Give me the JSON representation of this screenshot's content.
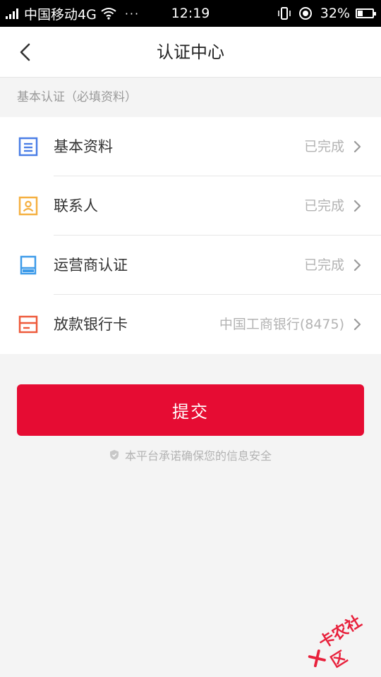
{
  "status_bar": {
    "carrier": "中国移动4G",
    "dots": "···",
    "time": "12:19",
    "battery_pct": "32%",
    "battery_level": 0.32
  },
  "nav": {
    "title": "认证中心"
  },
  "section": {
    "title": "基本认证（必填资料）"
  },
  "items": [
    {
      "label": "基本资料",
      "status": "已完成",
      "icon": "basic-info-icon",
      "color": "#4a7ee6"
    },
    {
      "label": "联系人",
      "status": "已完成",
      "icon": "contact-icon",
      "color": "#f5b041"
    },
    {
      "label": "运营商认证",
      "status": "已完成",
      "icon": "carrier-icon",
      "color": "#3d9be9"
    },
    {
      "label": "放款银行卡",
      "status": "中国工商银行(8475)",
      "icon": "bank-card-icon",
      "color": "#ee5a3b"
    }
  ],
  "submit": {
    "label": "提交",
    "color": "#e60c33"
  },
  "safety_note": "本平台承诺确保您的信息安全",
  "watermark": "卡农社区",
  "colors": {
    "accent": "#e60c33",
    "page_bg": "#f4f4f4",
    "muted": "#b3b3b3"
  }
}
